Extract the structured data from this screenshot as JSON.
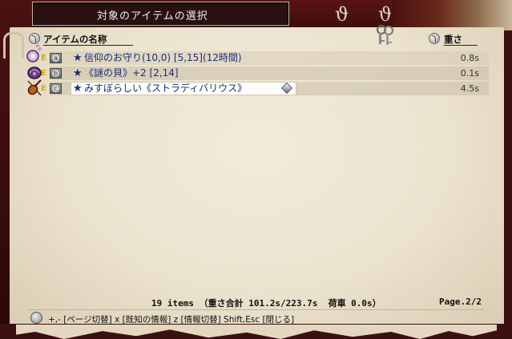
{
  "window": {
    "title": "対象のアイテムの選択"
  },
  "columns": {
    "name_header": "アイテムの名称",
    "weight_header": "重さ"
  },
  "items": [
    {
      "key": "a",
      "icon": "amulet-icon",
      "equipped_mark": "E",
      "star": "★",
      "name": "信仰のお守り(10,0) [5,15](12時間)",
      "weight": "0.8s",
      "selected": false
    },
    {
      "key": "b",
      "icon": "purple-shell-icon",
      "equipped_mark": "E",
      "star": "★",
      "name": "《謎の貝》+2 [2,14]",
      "weight": "0.1s",
      "selected": false
    },
    {
      "key": "c",
      "icon": "violin-icon",
      "equipped_mark": "E",
      "star": "★",
      "name": "みすぼらしい《ストラディバリウス》",
      "weight": "4.5s",
      "selected": true
    }
  ],
  "footer": {
    "summary": "19 items （重さ合計 101.2s/223.7s  荷車 0.0s）",
    "page": "Page.2/2",
    "help": "+,- [ページ切替]  x [既知の情報]  z [情報切替]  Shift,Esc [閉じる]"
  },
  "colors": {
    "item_text": "#1a2f7a",
    "parchment": "#ece3cf",
    "frame": "#3a1010"
  }
}
